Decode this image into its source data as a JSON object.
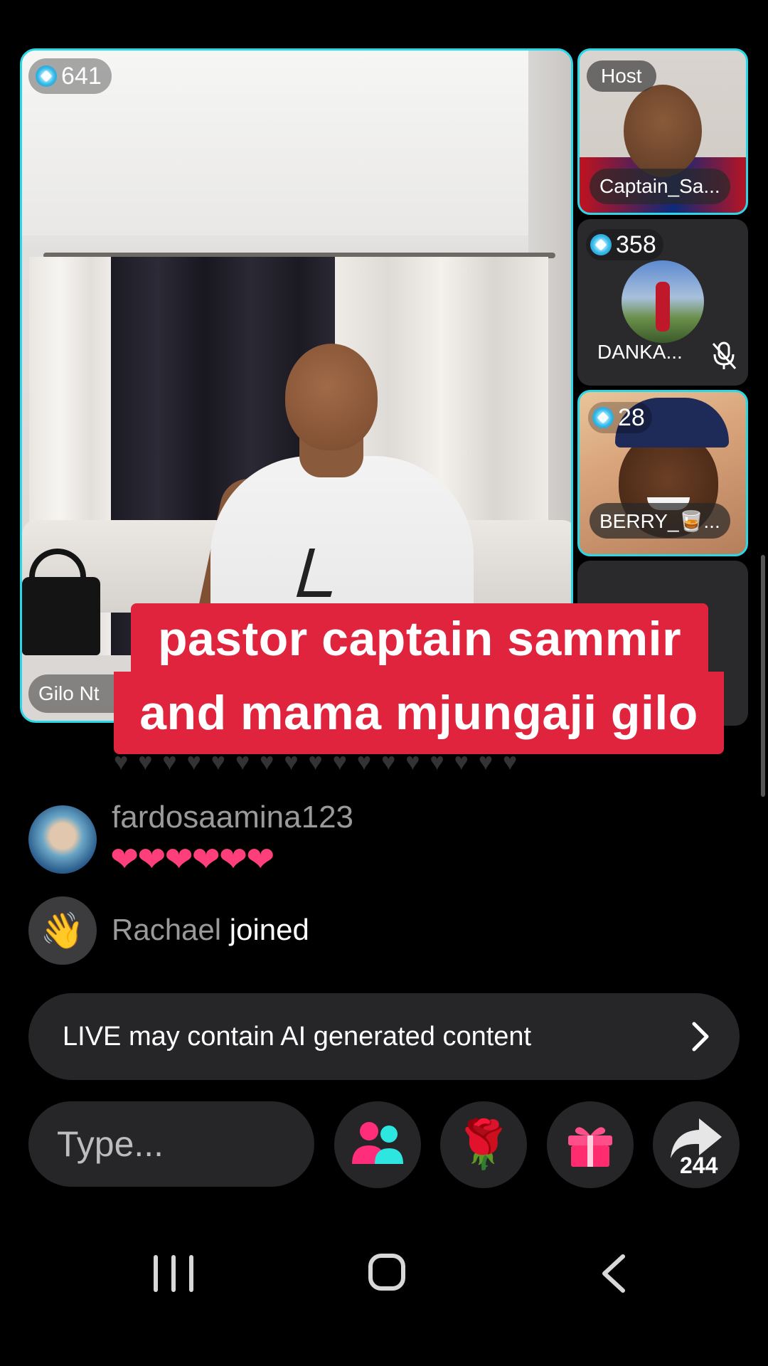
{
  "main_stream": {
    "viewer_count": "641",
    "streamer_name": "Gilo Nt"
  },
  "guests": [
    {
      "badge": "Host",
      "name": "Captain_Sa..."
    },
    {
      "viewer_count": "358",
      "name": "DANKA...",
      "mic": "muted"
    },
    {
      "viewer_count": "28",
      "name": "BERRY_🥃..."
    }
  ],
  "caption": {
    "line1": "pastor captain sammir",
    "line2": "and mama mjungaji gilo"
  },
  "chat": [
    {
      "username": "fardosaamina123",
      "message": "❤❤❤❤❤❤"
    },
    {
      "username": "Rachael",
      "action": "joined"
    }
  ],
  "ai_notice": {
    "text": "LIVE may contain AI generated content"
  },
  "composer": {
    "placeholder": "Type..."
  },
  "actions": {
    "people_icon": "people-icon",
    "rose_icon": "🌹",
    "gift_icon": "gift-icon",
    "share_count": "244"
  },
  "colors": {
    "accent_border": "#2ad7e6",
    "caption_bg": "#e0243d",
    "heart": "#ff3f7b",
    "panel": "#262628"
  }
}
